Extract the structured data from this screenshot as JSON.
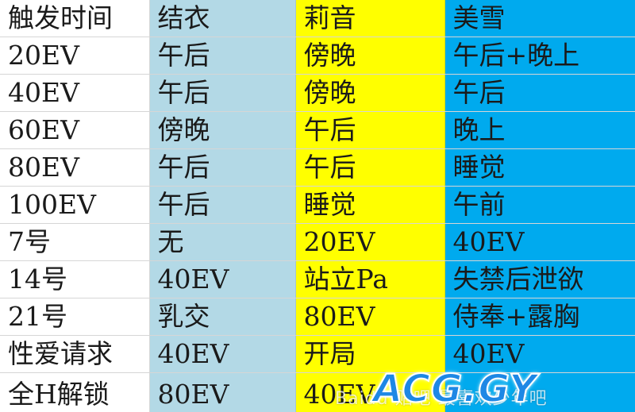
{
  "table": {
    "headers": [
      "触发时间",
      "结衣",
      "莉音",
      "美雪"
    ],
    "rows": [
      [
        "20EV",
        "午后",
        "傍晚",
        "午后+晚上"
      ],
      [
        "40EV",
        "午后",
        "傍晚",
        "午后"
      ],
      [
        "60EV",
        "傍晚",
        "午后",
        "晚上"
      ],
      [
        "80EV",
        "午后",
        "午后",
        "睡觉"
      ],
      [
        "100EV",
        "午后",
        "睡觉",
        "午前"
      ],
      [
        "7号",
        "无",
        "20EV",
        "40EV"
      ],
      [
        "14号",
        "40EV",
        "站立Pa",
        "失禁后泄欲"
      ],
      [
        "21号",
        "乳交",
        "80EV",
        "侍奉+露胸"
      ],
      [
        "性爱请求",
        "40EV",
        "开局",
        "40EV"
      ],
      [
        "全H解锁",
        "80EV",
        "40EV",
        ""
      ]
    ],
    "column_colors": [
      "#ffffff",
      "#b3d9e6",
      "#ffff00",
      "#00aaee"
    ]
  },
  "watermark": {
    "faint_text": "Baidu 贴吧 最喜欢少年吧",
    "logo_text": "ACG.GY"
  }
}
